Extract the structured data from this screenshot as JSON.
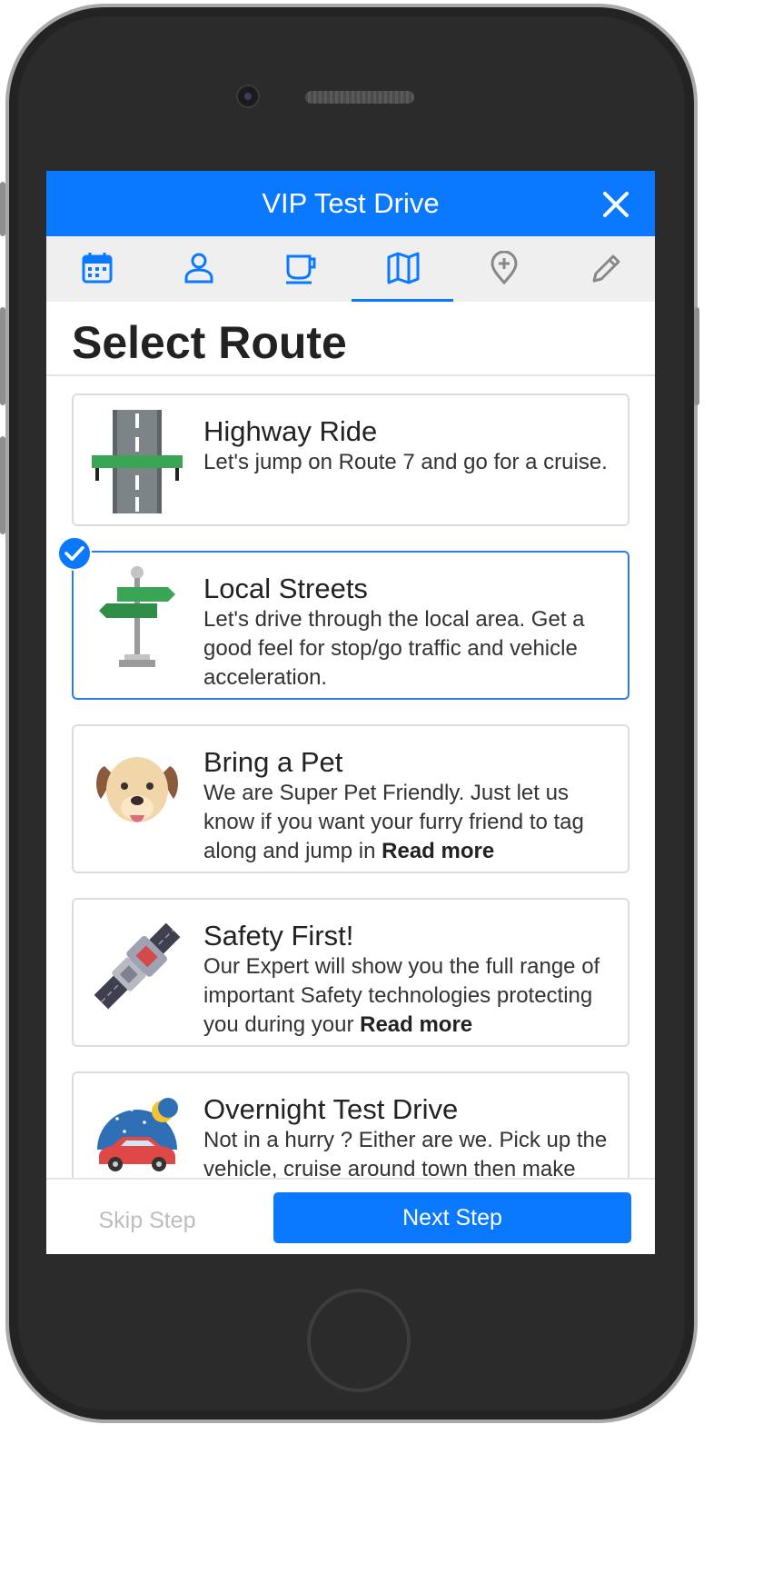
{
  "header": {
    "title": "VIP Test Drive"
  },
  "tabs": [
    {
      "icon": "calendar-icon"
    },
    {
      "icon": "person-icon"
    },
    {
      "icon": "coffee-cup-icon"
    },
    {
      "icon": "map-icon",
      "active": true
    },
    {
      "icon": "map-pin-plus-icon"
    },
    {
      "icon": "pencil-icon"
    }
  ],
  "page": {
    "heading": "Select Route"
  },
  "routes": [
    {
      "title": "Highway Ride",
      "description": "Let's jump on Route 7 and go for a cruise.",
      "icon": "highway-icon",
      "selected": false
    },
    {
      "title": "Local Streets",
      "description": "Let's drive through the local area. Get a good feel for stop/go traffic and vehicle acceleration.",
      "icon": "street-sign-icon",
      "selected": true
    },
    {
      "title": "Bring a Pet",
      "description": "We are Super Pet Friendly. Just let us know if you want your furry friend to tag along and jump in",
      "read_more": "Read more",
      "icon": "dog-icon",
      "selected": false
    },
    {
      "title": "Safety First!",
      "description": "Our Expert will show you the full range of important Safety technologies protecting you during your",
      "read_more": "Read more",
      "icon": "seatbelt-icon",
      "selected": false
    },
    {
      "title": "Overnight Test Drive",
      "description": "Not in a hurry ? Either are we. Pick up the vehicle, cruise around town then make",
      "icon": "car-night-icon",
      "selected": false
    }
  ],
  "footer": {
    "skip_label": "Skip Step",
    "next_label": "Next Step"
  },
  "colors": {
    "accent": "#0a78ff",
    "selected_border": "#2a7de1"
  }
}
